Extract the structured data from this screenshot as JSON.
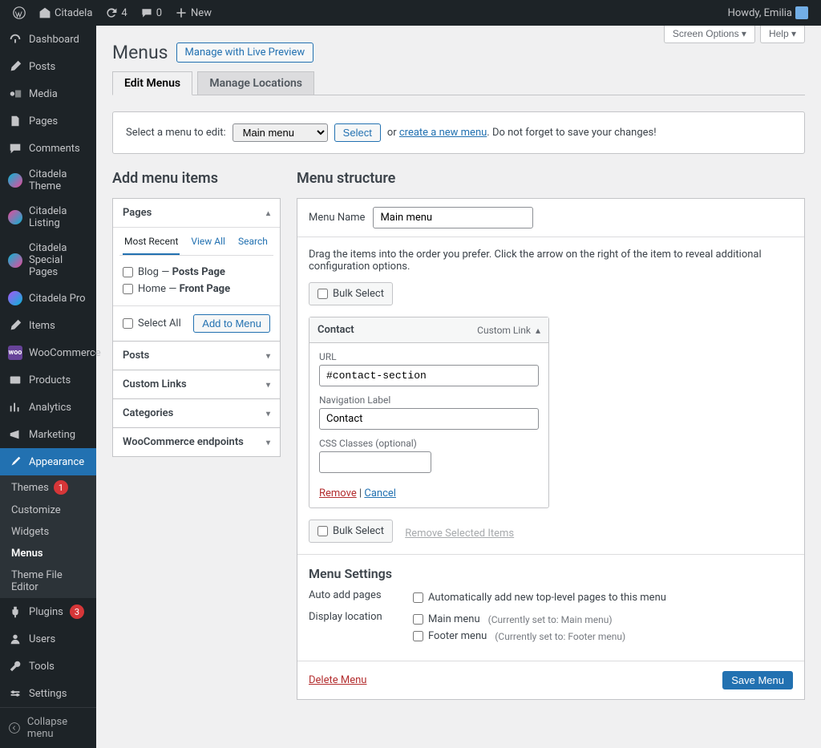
{
  "adminbar": {
    "site_name": "Citadela",
    "updates": "4",
    "comments": "0",
    "add_new": "New",
    "greeting": "Howdy, Emilia"
  },
  "sidebar": {
    "dashboard": "Dashboard",
    "posts": "Posts",
    "media": "Media",
    "pages": "Pages",
    "comments": "Comments",
    "citadela_theme": "Citadela Theme",
    "citadela_listing": "Citadela Listing",
    "citadela_special": "Citadela Special Pages",
    "citadela_pro": "Citadela Pro",
    "items": "Items",
    "woocommerce": "WooCommerce",
    "products": "Products",
    "analytics": "Analytics",
    "marketing": "Marketing",
    "appearance": "Appearance",
    "appearance_sub": {
      "themes": "Themes",
      "themes_badge": "1",
      "customize": "Customize",
      "widgets": "Widgets",
      "menus": "Menus",
      "theme_editor": "Theme File Editor"
    },
    "plugins": "Plugins",
    "plugins_badge": "3",
    "users": "Users",
    "tools": "Tools",
    "settings": "Settings",
    "collapse": "Collapse menu"
  },
  "screen_meta": {
    "screen_options": "Screen Options",
    "help": "Help"
  },
  "page": {
    "title": "Menus",
    "manage_preview": "Manage with Live Preview",
    "tab_edit": "Edit Menus",
    "tab_locations": "Manage Locations"
  },
  "select_bar": {
    "label": "Select a menu to edit:",
    "selected": "Main menu",
    "select_btn": "Select",
    "or": "or ",
    "create_link": "create a new menu",
    "tail": ". Do not forget to save your changes!"
  },
  "accordion": {
    "heading": "Add menu items",
    "pages": {
      "title": "Pages",
      "tab_recent": "Most Recent",
      "tab_all": "View All",
      "tab_search": "Search",
      "item_blog_pre": "Blog — ",
      "item_blog_post": "Posts Page",
      "item_home_pre": "Home — ",
      "item_home_post": "Front Page",
      "select_all": "Select All",
      "add_btn": "Add to Menu"
    },
    "posts": "Posts",
    "custom_links": "Custom Links",
    "categories": "Categories",
    "woocommerce_ep": "WooCommerce endpoints"
  },
  "structure": {
    "heading": "Menu structure",
    "menu_name_label": "Menu Name",
    "menu_name_value": "Main menu",
    "hint": "Drag the items into the order you prefer. Click the arrow on the right of the item to reveal additional configuration options.",
    "bulk_select": "Bulk Select",
    "item": {
      "label": "Contact",
      "type": "Custom Link",
      "url_label": "URL",
      "url_value": "#contact-section",
      "nav_label": "Navigation Label",
      "nav_value": "Contact",
      "css_label": "CSS Classes (optional)",
      "css_value": "",
      "remove": "Remove",
      "cancel": "Cancel"
    },
    "remove_selected": "Remove Selected Items",
    "settings": {
      "heading": "Menu Settings",
      "auto_add_label": "Auto add pages",
      "auto_add_text": "Automatically add new top-level pages to this menu",
      "display_loc_label": "Display location",
      "main_menu": "Main menu",
      "main_menu_note": "(Currently set to: Main menu)",
      "footer_menu": "Footer menu",
      "footer_menu_note": "(Currently set to: Footer menu)"
    },
    "footer": {
      "delete": "Delete Menu",
      "save": "Save Menu"
    }
  }
}
